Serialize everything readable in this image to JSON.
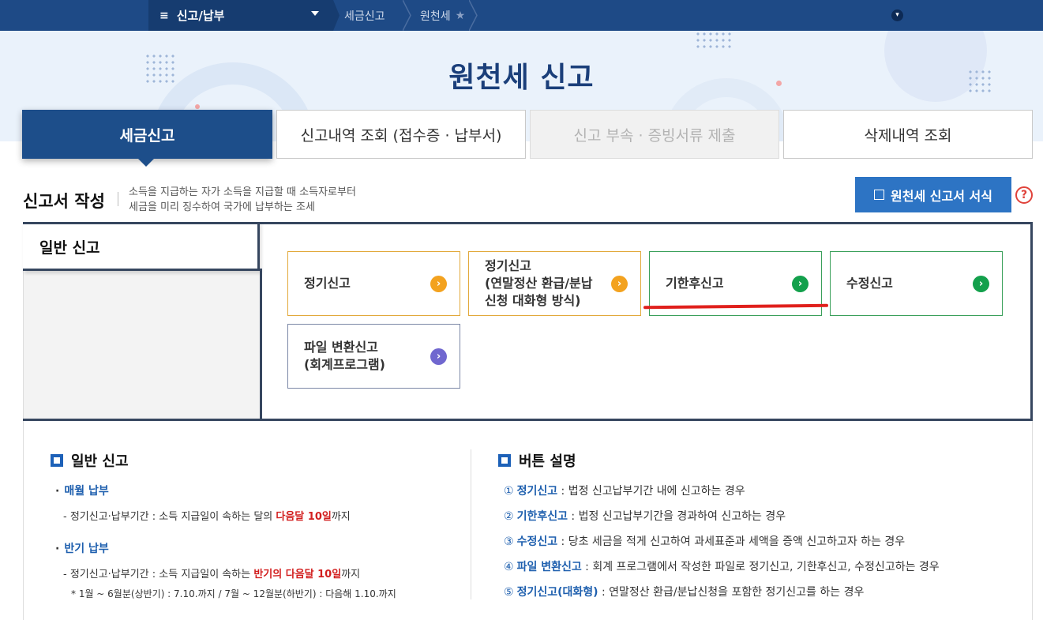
{
  "topnav": {
    "menu_label": "신고/납부",
    "breadcrumb_1": "세금신고",
    "breadcrumb_2": "원천세"
  },
  "hero": {
    "title": "원천세 신고"
  },
  "tabs": [
    {
      "label": "세금신고"
    },
    {
      "label": "신고내역 조회 (접수증 · 납부서)"
    },
    {
      "label": "신고 부속 · 증빙서류 제출"
    },
    {
      "label": "삭제내역 조회"
    }
  ],
  "section": {
    "title": "신고서 작성",
    "desc_line1": "소득을 지급하는 자가 소득을 지급할 때 소득자로부터",
    "desc_line2": "세금을 미리 징수하여 국가에 납부하는 조세",
    "form_button": "원천세 신고서 서식",
    "help": "?"
  },
  "general": {
    "label": "일반 신고",
    "options": [
      {
        "line1": "정기신고",
        "line2": "",
        "line3": ""
      },
      {
        "line1": "정기신고",
        "line2": "(연말정산 환급/분납",
        "line3": "신청 대화형 방식)"
      },
      {
        "line1": "기한후신고",
        "line2": "",
        "line3": ""
      },
      {
        "line1": "수정신고",
        "line2": "",
        "line3": ""
      },
      {
        "line1": "파일 변환신고",
        "line2": "(회계프로그램)",
        "line3": ""
      }
    ]
  },
  "info_left": {
    "heading": "일반 신고",
    "monthly_title": "매월 납부",
    "monthly_prefix": "- 정기신고·납부기간 : 소득 지급일이 속하는 달의 ",
    "monthly_red": "다음달 10일",
    "monthly_suffix": "까지",
    "half_title": "반기 납부",
    "half_prefix": "- 정기신고·납부기간 : 소득 지급일이 속하는 ",
    "half_red": "반기의 다음달 10일",
    "half_suffix": "까지",
    "half_note": "* 1월 ~ 6월분(상반기) : 7.10.까지 / 7월 ~ 12월분(하반기) : 다음해 1.10.까지"
  },
  "info_right": {
    "heading": "버튼 설명",
    "items": [
      {
        "num": "①",
        "kw": "정기신고",
        "text": " : 법정 신고납부기간 내에 신고하는 경우"
      },
      {
        "num": "②",
        "kw": "기한후신고",
        "text": " : 법정 신고납부기간을 경과하여 신고하는 경우"
      },
      {
        "num": "③",
        "kw": "수정신고",
        "text": " : 당초 세금을 적게 신고하여 과세표준과 세액을 증액 신고하고자 하는 경우"
      },
      {
        "num": "④",
        "kw": "파일 변환신고",
        "text": " : 회계 프로그램에서 작성한 파일로 정기신고, 기한후신고, 수정신고하는 경우"
      },
      {
        "num": "⑤",
        "kw": "정기신고(대화형)",
        "text": " : 연말정산 환급/분납신청을 포함한 정기신고를 하는 경우"
      }
    ]
  },
  "colors": {
    "nav": "#1e4a86",
    "active_tab": "#1d4e8a",
    "form_button": "#2d74c4",
    "accent_red": "#d21e1e",
    "yellow": "#f3a21f",
    "green": "#13a04c",
    "purple": "#7067cf"
  },
  "icons": [
    "hamburger-icon",
    "chevron-down-icon",
    "star-icon",
    "edit-icon",
    "help-icon",
    "arrow-right-icon"
  ]
}
